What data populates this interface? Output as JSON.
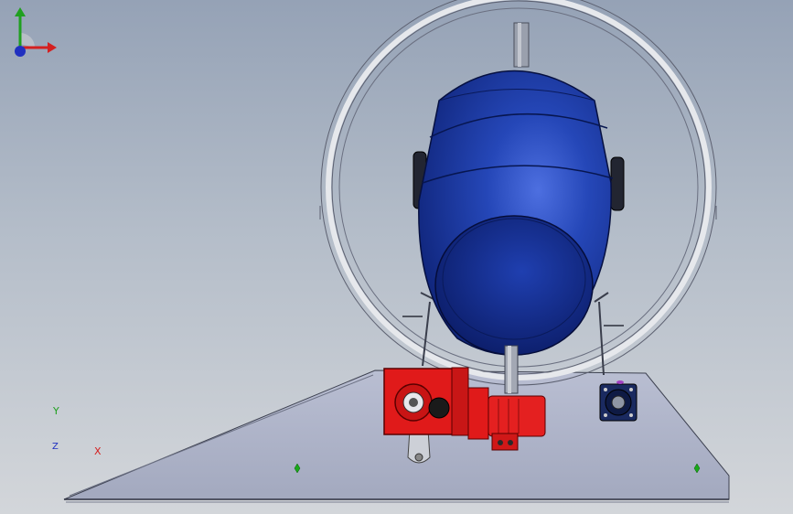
{
  "viewport": {
    "background_top": "#95a2b6",
    "background_bottom": "#d3d6da"
  },
  "model": {
    "drum_color": "#1c3aa0",
    "gearbox_color": "#e01a1a",
    "base_color": "#a8aec4",
    "ring_color": "#cdd1d8",
    "bearing_color": "#1a2a60"
  },
  "triad": {
    "x_label": "X",
    "y_label": "Y",
    "z_label": "Z",
    "x_color": "#d42020",
    "y_color": "#20a020",
    "z_color": "#2030c0"
  }
}
